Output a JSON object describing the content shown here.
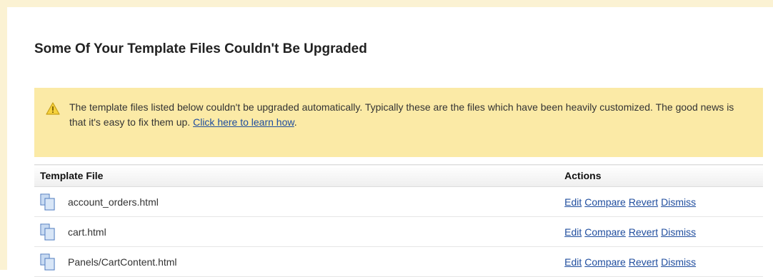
{
  "panel": {
    "title": "Some Of Your Template Files Couldn't Be Upgraded"
  },
  "warning": {
    "icon": "warning-triangle-icon",
    "text": "The template files listed below couldn't be upgraded automatically. Typically these are the files which have been heavily customized. The good news is that it's easy to fix them up.",
    "link_label": "Click here to learn how",
    "trailing": "."
  },
  "table": {
    "headers": {
      "file": "Template File",
      "actions": "Actions"
    },
    "file_icon": "document-copy-icon",
    "rows": [
      {
        "file": "account_orders.html",
        "actions": [
          "Edit",
          "Compare",
          "Revert",
          "Dismiss"
        ]
      },
      {
        "file": "cart.html",
        "actions": [
          "Edit",
          "Compare",
          "Revert",
          "Dismiss"
        ]
      },
      {
        "file": "Panels/CartContent.html",
        "actions": [
          "Edit",
          "Compare",
          "Revert",
          "Dismiss"
        ]
      }
    ]
  },
  "colors": {
    "warning_bg": "#fbeaa6",
    "frame_bg": "#fbf2d3",
    "link": "#1f4d9e"
  }
}
